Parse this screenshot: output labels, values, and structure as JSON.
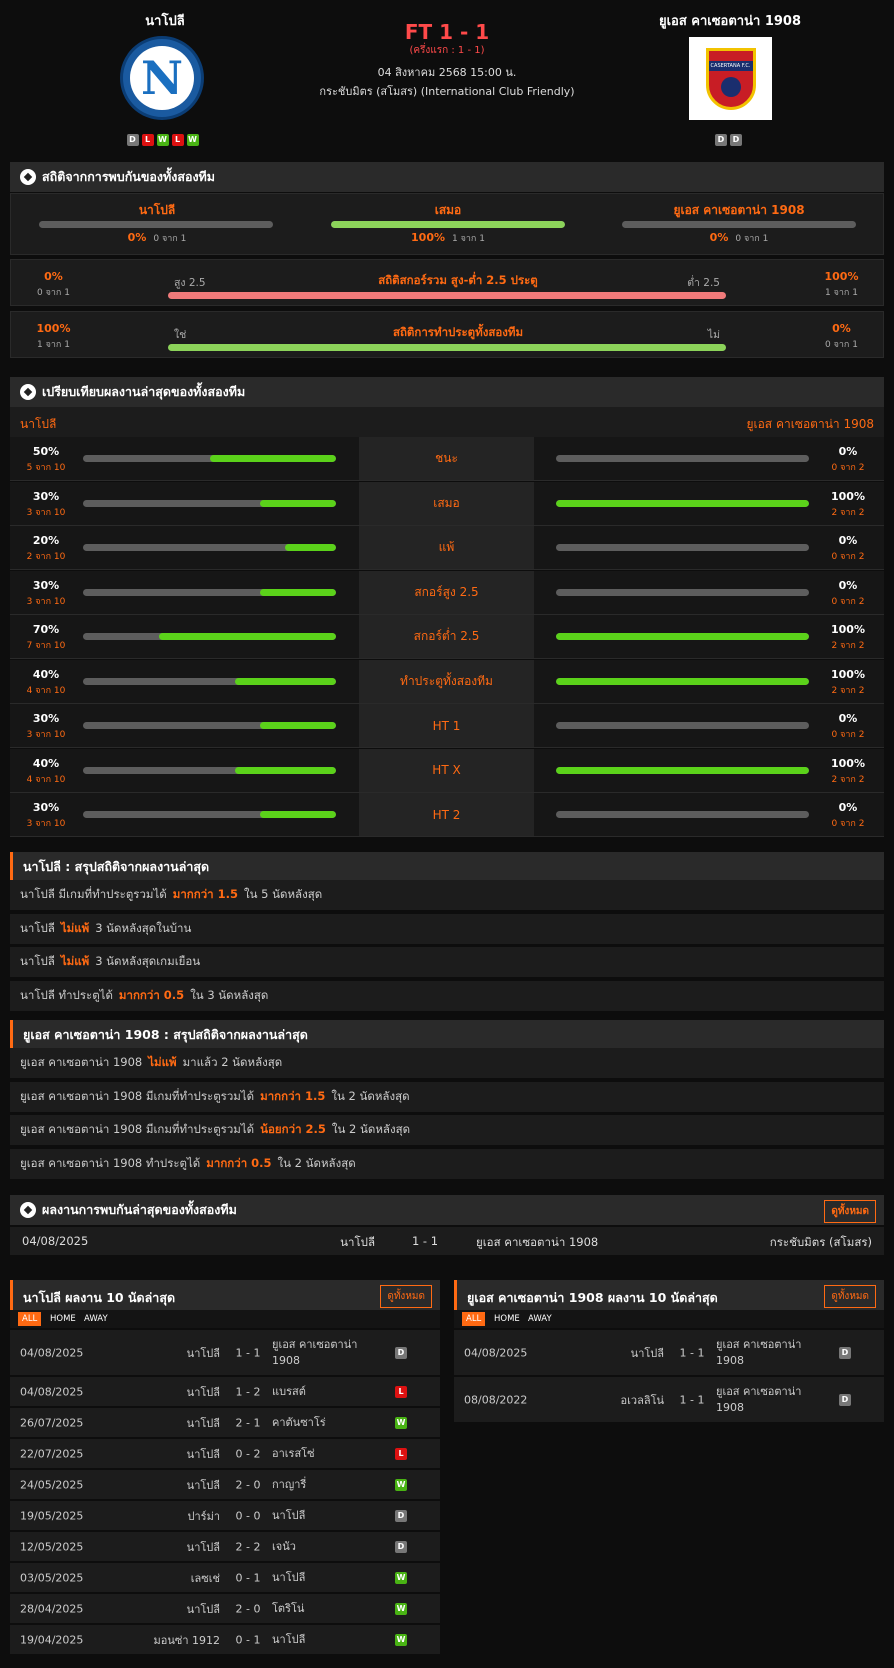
{
  "match": {
    "home": "นาโปลี",
    "away": "ยูเอส คาเซอตาน่า 1908",
    "score": "FT 1 - 1",
    "ht": "(ครึ่งแรก : 1 - 1)",
    "date": "04 สิงหาคม 2568 15:00 น.",
    "competition": "กระชับมิตร (สโมสร) (International Club Friendly)",
    "home_form": [
      "D",
      "L",
      "W",
      "L",
      "W"
    ],
    "away_form": [
      "D",
      "D"
    ],
    "home_logo_letter": "N",
    "away_logo_text": "CASERTANA F.C."
  },
  "h2h": {
    "title": "สถิติจากการพบกันของทั้งสองทีม",
    "cols": [
      {
        "label": "นาโปลี",
        "pct": "0%",
        "sub": "0 จาก 1",
        "fill": 0
      },
      {
        "label": "เสมอ",
        "pct": "100%",
        "sub": "1 จาก 1",
        "fill": 100
      },
      {
        "label": "ยูเอส คาเซอตาน่า 1908",
        "pct": "0%",
        "sub": "0 จาก 1",
        "fill": 0
      }
    ]
  },
  "ou": {
    "left_pct": "0%",
    "left_sub": "0 จาก 1",
    "title": "สถิติสกอร์รวม สูง-ต่ำ 2.5 ประตู",
    "left_label": "สูง 2.5",
    "right_label": "ต่ำ 2.5",
    "right_pct": "100%",
    "right_sub": "1 จาก 1"
  },
  "btts": {
    "left_pct": "100%",
    "left_sub": "1 จาก 1",
    "title": "สถิติการทำประตูทั้งสองทีม",
    "left_label": "ใช่",
    "right_label": "ไม่",
    "right_pct": "0%",
    "right_sub": "0 จาก 1"
  },
  "compare": {
    "title": "เปรียบเทียบผลงานล่าสุดของทั้งสองทีม",
    "home": "นาโปลี",
    "away": "ยูเอส คาเซอตาน่า 1908",
    "rows": [
      {
        "label": "ชนะ",
        "lp": "50%",
        "ls": "5 จาก 10",
        "lf": 50,
        "rp": "0%",
        "rs": "0 จาก 2",
        "rf": 0
      },
      {
        "label": "เสมอ",
        "lp": "30%",
        "ls": "3 จาก 10",
        "lf": 30,
        "rp": "100%",
        "rs": "2 จาก 2",
        "rf": 100
      },
      {
        "label": "แพ้",
        "lp": "20%",
        "ls": "2 จาก 10",
        "lf": 20,
        "rp": "0%",
        "rs": "0 จาก 2",
        "rf": 0
      },
      {
        "label": "สกอร์สูง 2.5",
        "lp": "30%",
        "ls": "3 จาก 10",
        "lf": 30,
        "rp": "0%",
        "rs": "0 จาก 2",
        "rf": 0
      },
      {
        "label": "สกอร์ต่ำ 2.5",
        "lp": "70%",
        "ls": "7 จาก 10",
        "lf": 70,
        "rp": "100%",
        "rs": "2 จาก 2",
        "rf": 100
      },
      {
        "label": "ทำประตูทั้งสองทีม",
        "lp": "40%",
        "ls": "4 จาก 10",
        "lf": 40,
        "rp": "100%",
        "rs": "2 จาก 2",
        "rf": 100
      },
      {
        "label": "HT 1",
        "lp": "30%",
        "ls": "3 จาก 10",
        "lf": 30,
        "rp": "0%",
        "rs": "0 จาก 2",
        "rf": 0
      },
      {
        "label": "HT X",
        "lp": "40%",
        "ls": "4 จาก 10",
        "lf": 40,
        "rp": "100%",
        "rs": "2 จาก 2",
        "rf": 100
      },
      {
        "label": "HT 2",
        "lp": "30%",
        "ls": "3 จาก 10",
        "lf": 30,
        "rp": "0%",
        "rs": "0 จาก 2",
        "rf": 0
      }
    ]
  },
  "home_summary": {
    "title": "นาโปลี : สรุปสถิติจากผลงานล่าสุด",
    "rows": [
      {
        "a": "นาโปลี  มีเกมที่ทำประตูรวมได้",
        "h": "มากกว่า  1.5",
        "b": "ใน 5 นัดหลังสุด"
      },
      {
        "a": "นาโปลี",
        "h": "ไม่แพ้",
        "b": "3  นัดหลังสุดในบ้าน"
      },
      {
        "a": "นาโปลี",
        "h": "ไม่แพ้",
        "b": "3  นัดหลังสุดเกมเยือน"
      },
      {
        "a": "นาโปลี  ทำประตูได้",
        "h": "มากกว่า  0.5",
        "b": "ใน 3 นัดหลังสุด"
      }
    ]
  },
  "away_summary": {
    "title": "ยูเอส คาเซอตาน่า 1908 : สรุปสถิติจากผลงานล่าสุด",
    "rows": [
      {
        "a": "ยูเอส คาเซอตาน่า 1908",
        "h": "ไม่แพ้",
        "b": "มาแล้ว 2 นัดหลังสุด"
      },
      {
        "a": "ยูเอส คาเซอตาน่า 1908  มีเกมที่ทำประตูรวมได้",
        "h": "มากกว่า  1.5",
        "b": "ใน 2 นัดหลังสุด"
      },
      {
        "a": "ยูเอส คาเซอตาน่า 1908  มีเกมที่ทำประตูรวมได้",
        "h": "น้อยกว่า  2.5",
        "b": "ใน 2 นัดหลังสุด"
      },
      {
        "a": "ยูเอส คาเซอตาน่า 1908  ทำประตูได้",
        "h": "มากกว่า  0.5",
        "b": "ใน 2 นัดหลังสุด"
      }
    ]
  },
  "h2h_results": {
    "title": "ผลงานการพบกันล่าสุดของทั้งสองทีม",
    "view_all": "ดูทั้งหมด",
    "rows": [
      {
        "date": "04/08/2025",
        "home": "นาโปลี",
        "score": "1 - 1",
        "away": "ยูเอส คาเซอตาน่า 1908",
        "comp": "กระชับมิตร (สโมสร)"
      }
    ]
  },
  "home_last10": {
    "title": "นาโปลี ผลงาน 10 นัดล่าสุด",
    "view_all": "ดูทั้งหมด",
    "tabs": [
      "ALL",
      "HOME",
      "AWAY"
    ],
    "rows": [
      {
        "date": "04/08/2025",
        "home": "นาโปลี",
        "score": "1 - 1",
        "away": "ยูเอส คาเซอตาน่า 1908",
        "r": "D"
      },
      {
        "date": "04/08/2025",
        "home": "นาโปลี",
        "score": "1 - 2",
        "away": "แบรสต์",
        "r": "L"
      },
      {
        "date": "26/07/2025",
        "home": "นาโปลี",
        "score": "2 - 1",
        "away": "คาตันซาโร่",
        "r": "W"
      },
      {
        "date": "22/07/2025",
        "home": "นาโปลี",
        "score": "0 - 2",
        "away": "อาเรสโซ่",
        "r": "L"
      },
      {
        "date": "24/05/2025",
        "home": "นาโปลี",
        "score": "2 - 0",
        "away": "กาญารี่",
        "r": "W"
      },
      {
        "date": "19/05/2025",
        "home": "ปาร์ม่า",
        "score": "0 - 0",
        "away": "นาโปลี",
        "r": "D"
      },
      {
        "date": "12/05/2025",
        "home": "นาโปลี",
        "score": "2 - 2",
        "away": "เจนัว",
        "r": "D"
      },
      {
        "date": "03/05/2025",
        "home": "เลซเช่",
        "score": "0 - 1",
        "away": "นาโปลี",
        "r": "W"
      },
      {
        "date": "28/04/2025",
        "home": "นาโปลี",
        "score": "2 - 0",
        "away": "โตริโน่",
        "r": "W"
      },
      {
        "date": "19/04/2025",
        "home": "มอนซ่า 1912",
        "score": "0 - 1",
        "away": "นาโปลี",
        "r": "W"
      }
    ]
  },
  "away_last10": {
    "title": "ยูเอส คาเซอตาน่า 1908 ผลงาน 10 นัดล่าสุด",
    "view_all": "ดูทั้งหมด",
    "tabs": [
      "ALL",
      "HOME",
      "AWAY"
    ],
    "rows": [
      {
        "date": "04/08/2025",
        "home": "นาโปลี",
        "score": "1 - 1",
        "away": "ยูเอส คาเซอตาน่า 1908",
        "r": "D"
      },
      {
        "date": "08/08/2022",
        "home": "อเวลลิโน่",
        "score": "1 - 1",
        "away": "ยูเอส คาเซอตาน่า 1908",
        "r": "D"
      }
    ]
  }
}
